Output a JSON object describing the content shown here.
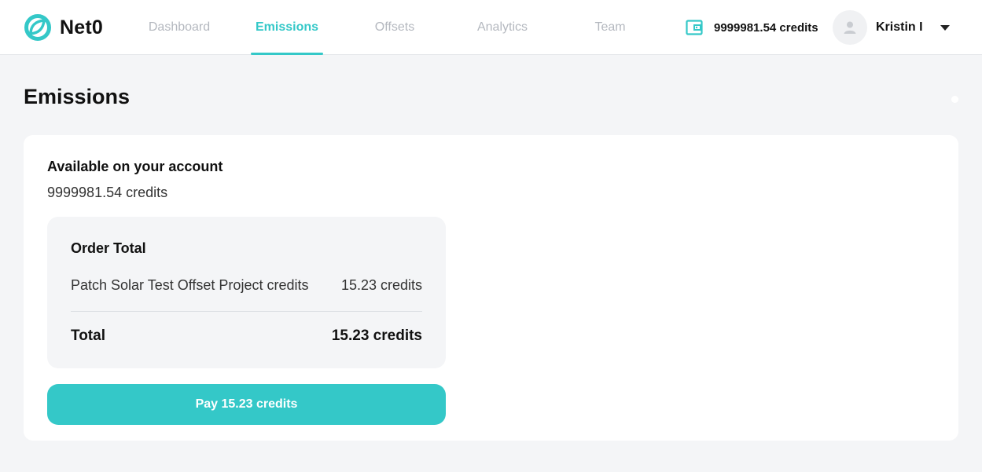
{
  "app": {
    "name": "Net0"
  },
  "nav": {
    "items": [
      {
        "label": "Dashboard",
        "active": false
      },
      {
        "label": "Emissions",
        "active": true
      },
      {
        "label": "Offsets",
        "active": false
      },
      {
        "label": "Analytics",
        "active": false
      },
      {
        "label": "Team",
        "active": false
      }
    ]
  },
  "wallet": {
    "amount": "9999981.54 credits",
    "icon": "wallet-icon"
  },
  "user": {
    "name": "Kristin I",
    "icon": "user-avatar-icon"
  },
  "page": {
    "title": "Emissions"
  },
  "account": {
    "label": "Available on your account",
    "value": "9999981.54 credits"
  },
  "order": {
    "title": "Order Total",
    "line_item": {
      "name": "Patch Solar Test Offset Project credits",
      "amount": "15.23 credits"
    },
    "total_label": "Total",
    "total_amount": "15.23 credits"
  },
  "pay_button": {
    "label": "Pay 15.23 credits"
  },
  "colors": {
    "accent": "#34c8c8",
    "background": "#f4f5f7",
    "card": "#ffffff"
  }
}
